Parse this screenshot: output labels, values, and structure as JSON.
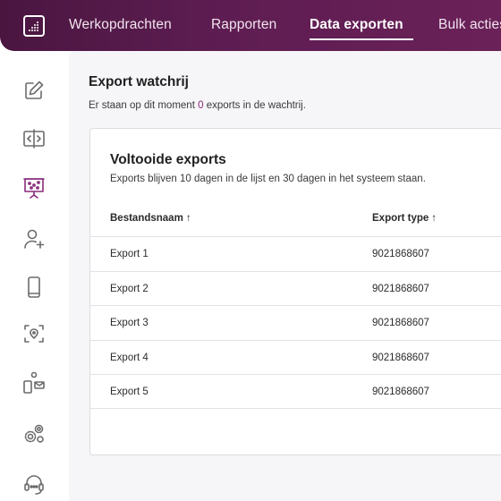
{
  "nav": {
    "items": [
      {
        "label": "Werkopdrachten"
      },
      {
        "label": "Rapporten"
      },
      {
        "label": "Data exporten"
      },
      {
        "label": "Bulk acties"
      }
    ],
    "active_index": 2
  },
  "sidebar": {
    "items": [
      {
        "icon": "edit-icon"
      },
      {
        "icon": "split-view-icon"
      },
      {
        "icon": "presentation-board-icon",
        "active": true
      },
      {
        "icon": "add-user-icon"
      },
      {
        "icon": "mobile-device-icon"
      },
      {
        "icon": "scan-target-icon"
      },
      {
        "icon": "device-mail-icon"
      },
      {
        "icon": "gears-icon"
      },
      {
        "icon": "support-headset-icon"
      }
    ]
  },
  "main": {
    "title": "Export watchrij",
    "queue_prefix": "Er staan op dit moment",
    "queue_count": "0",
    "queue_suffix": "exports in de wachtrij."
  },
  "card": {
    "title": "Voltooide exports",
    "subtitle": "Exports blijven 10 dagen in de lijst en 30 dagen in het systeem staan.",
    "columns": [
      {
        "label": "Bestandsnaam",
        "sort": "↑"
      },
      {
        "label": "Export type",
        "sort": "↑"
      }
    ],
    "rows": [
      {
        "name": "Export 1",
        "type": "9021868607"
      },
      {
        "name": "Export 2",
        "type": "9021868607"
      },
      {
        "name": "Export 3",
        "type": "9021868607"
      },
      {
        "name": "Export 4",
        "type": "9021868607"
      },
      {
        "name": "Export 5",
        "type": "9021868607"
      }
    ]
  },
  "colors": {
    "accent": "#8a2c7c",
    "topbar": "#5e1d52",
    "icon": "#6b6b6b"
  }
}
